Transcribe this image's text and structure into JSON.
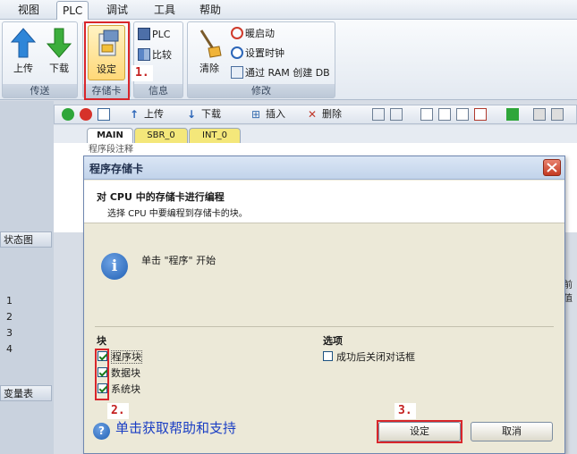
{
  "menu": [
    "视图",
    "PLC",
    "调试",
    "工具",
    "帮助"
  ],
  "ribbon": {
    "groups": {
      "transfer": {
        "label": "传送",
        "upload": "上传",
        "download": "下载"
      },
      "memory_card": {
        "label": "存储卡",
        "setup": "设定"
      },
      "info": {
        "label": "信息",
        "plc": "PLC",
        "compare": "比较"
      },
      "modify": {
        "label": "修改",
        "clear": "清除",
        "warm_start": "暖启动",
        "set_clock": "设置时钟",
        "ram_to_db": "通过 RAM 创建 DB"
      }
    }
  },
  "annotations": {
    "step1": "1.",
    "step2": "2.",
    "step3": "3."
  },
  "toolbar": {
    "upload": "上传",
    "download": "下载",
    "insert": "插入",
    "delete": "删除"
  },
  "tabs": [
    "MAIN",
    "SBR_0",
    "INT_0"
  ],
  "editor": {
    "comment": "程序段注释"
  },
  "left_panes": {
    "status": "状态图",
    "var": "变量表",
    "rows": [
      "1",
      "2",
      "3",
      "4"
    ],
    "prev": "前值"
  },
  "dialog": {
    "title": "程序存储卡",
    "header_title": "对 CPU 中的存储卡进行编程",
    "header_subtitle": "选择 CPU 中要编程到存储卡的块。",
    "info_text": "单击 \"程序\" 开始",
    "blocks_label": "块",
    "options_label": "选项",
    "checkboxes": [
      {
        "label": "程序块",
        "checked": true
      },
      {
        "label": "数据块",
        "checked": true
      },
      {
        "label": "系统块",
        "checked": true
      }
    ],
    "option_close": {
      "label": "成功后关闭对话框",
      "checked": false
    },
    "help": "单击获取帮助和支持",
    "ok": "设定",
    "cancel": "取消"
  }
}
